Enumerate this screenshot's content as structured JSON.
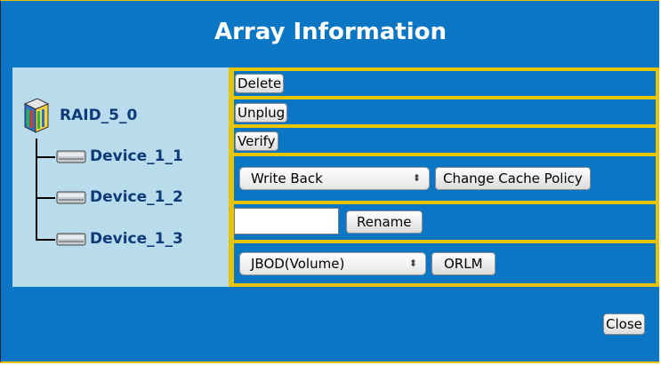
{
  "dialog": {
    "title": "Array Information",
    "close_label": "Close"
  },
  "tree": {
    "root_label": "RAID_5_0",
    "root_icon": "raid-array-icon",
    "devices": [
      {
        "label": "Device_1_1",
        "icon": "hard-disk-icon"
      },
      {
        "label": "Device_1_2",
        "icon": "hard-disk-icon"
      },
      {
        "label": "Device_1_3",
        "icon": "hard-disk-icon"
      }
    ]
  },
  "actions": {
    "delete_label": "Delete",
    "unplug_label": "Unplug",
    "verify_label": "Verify",
    "cache_policy_selected": "Write Back",
    "change_cache_label": "Change Cache Policy",
    "rename_value": "",
    "rename_label": "Rename",
    "migrate_selected": "JBOD(Volume)",
    "orlm_label": "ORLM"
  },
  "colors": {
    "dialog_bg": "#0a76c4",
    "tree_bg": "#b9dcec",
    "frame_accent": "#e8c400",
    "tree_text": "#0e3a78"
  }
}
